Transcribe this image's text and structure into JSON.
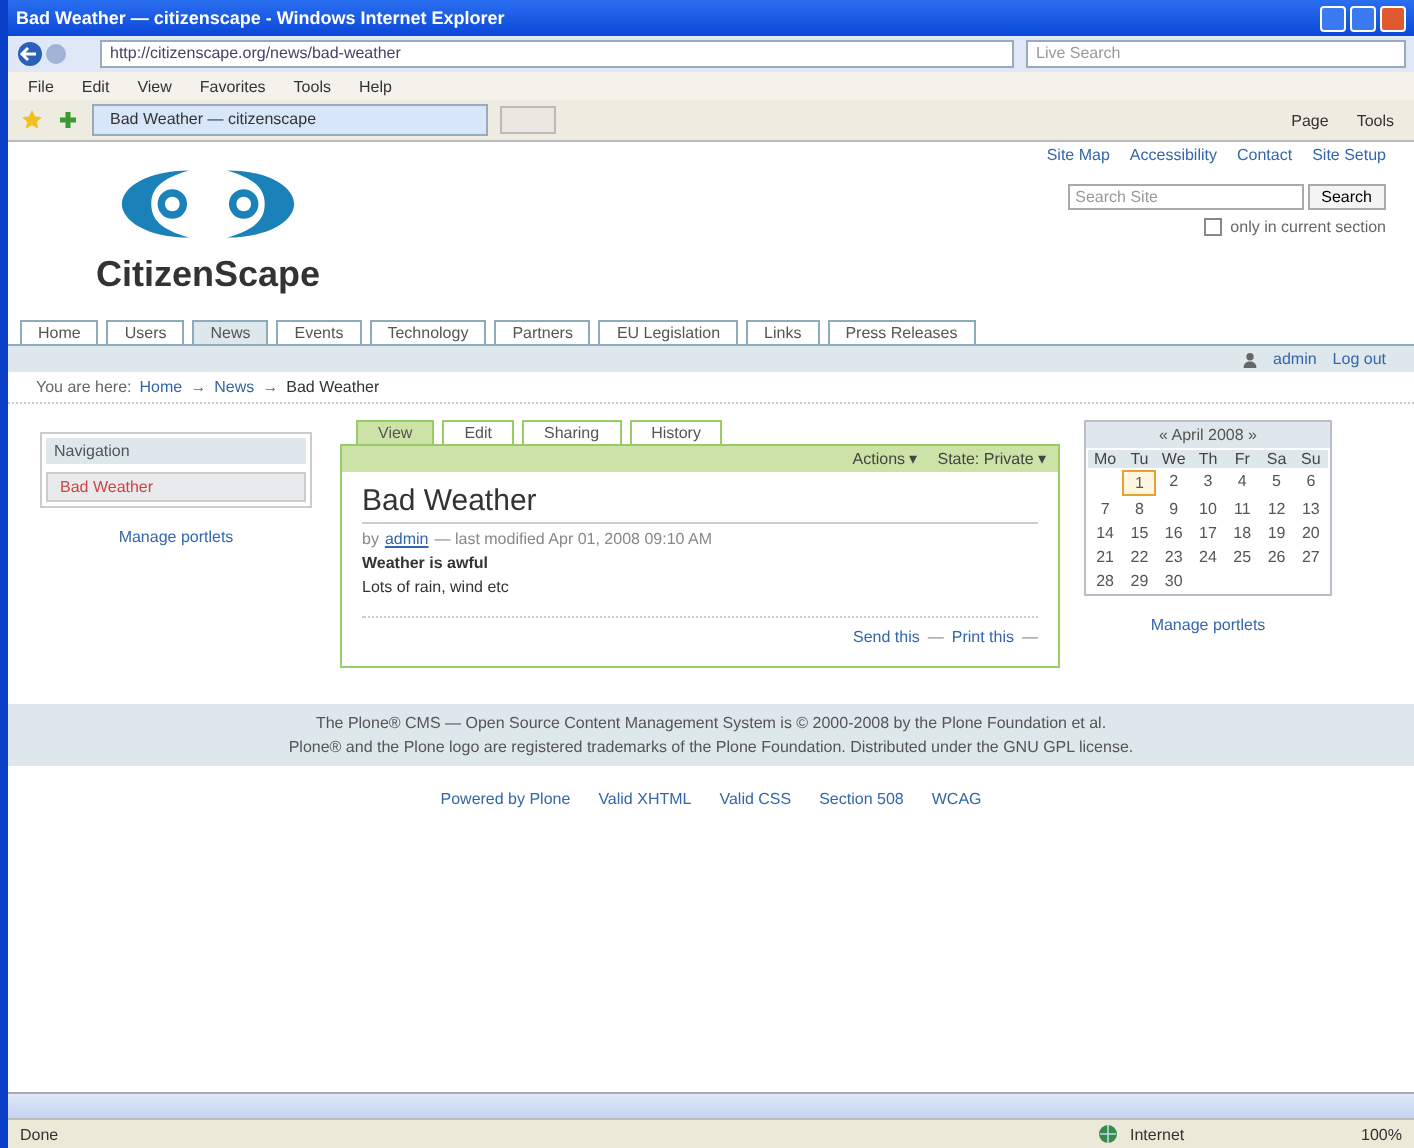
{
  "window": {
    "title": "Bad Weather — citizenscape - Windows Internet Explorer"
  },
  "address_bar": {
    "url": "http://citizenscape.org/news/bad-weather",
    "search_placeholder": "Live Search"
  },
  "menu": [
    "File",
    "Edit",
    "View",
    "Favorites",
    "Tools",
    "Help"
  ],
  "browser_tab": {
    "label": "Bad Weather — citizenscape"
  },
  "toolbar": [
    "Page",
    "Tools"
  ],
  "page": {
    "site_actions": [
      "Site Map",
      "Accessibility",
      "Contact",
      "Site Setup"
    ],
    "search": {
      "placeholder": "Search Site",
      "button": "Search",
      "option": "only in current section",
      "checked": false
    },
    "logo": {
      "text": "CitizenScape"
    },
    "nav_tabs": [
      {
        "label": "Home",
        "selected": false
      },
      {
        "label": "Users",
        "selected": false
      },
      {
        "label": "News",
        "selected": true
      },
      {
        "label": "Events",
        "selected": false
      },
      {
        "label": "Technology",
        "selected": false
      },
      {
        "label": "Partners",
        "selected": false
      },
      {
        "label": "EU Legislation",
        "selected": false
      },
      {
        "label": "Links",
        "selected": false
      },
      {
        "label": "Press Releases",
        "selected": false
      }
    ],
    "user_actions": [
      "admin",
      "Log out"
    ],
    "breadcrumb": {
      "label": "You are here:",
      "separator": "→",
      "items": [
        "Home",
        "News",
        "Bad Weather"
      ]
    },
    "nav_portlet": {
      "title": "Navigation",
      "items": [
        {
          "label": "Bad Weather",
          "selected": true
        }
      ],
      "manage": "Manage portlets"
    },
    "content_tabs": [
      {
        "label": "View",
        "selected": true
      },
      {
        "label": "Edit",
        "selected": false
      },
      {
        "label": "Sharing",
        "selected": false
      },
      {
        "label": "History",
        "selected": false
      }
    ],
    "content_menus": [
      "Actions ▾",
      "State: Private ▾"
    ],
    "article": {
      "title": "Bad Weather",
      "byline_prefix": "by",
      "author": "admin",
      "byline_rest": "— last modified Apr 01, 2008 09:10 AM",
      "description": "Weather is awful",
      "body": "Lots of rain, wind etc",
      "document_actions": [
        "Send this",
        "Print this"
      ],
      "action_separator": "—"
    },
    "calendar": {
      "title": "« April 2008 »",
      "weekdays": [
        "Mo",
        "Tu",
        "We",
        "Th",
        "Fr",
        "Sa",
        "Su"
      ],
      "weeks": [
        [
          {
            "kind": "blank"
          },
          {
            "label": "1",
            "today": true
          },
          {
            "label": "2",
            "today": false
          },
          {
            "label": "3",
            "today": false
          },
          {
            "label": "4",
            "today": false
          },
          {
            "label": "5",
            "today": false
          },
          {
            "label": "6",
            "today": false
          }
        ],
        [
          {
            "label": "7",
            "today": false
          },
          {
            "label": "8",
            "today": false
          },
          {
            "label": "9",
            "today": false
          },
          {
            "label": "10",
            "today": false
          },
          {
            "label": "11",
            "today": false
          },
          {
            "label": "12",
            "today": false
          },
          {
            "label": "13",
            "today": false
          }
        ],
        [
          {
            "label": "14",
            "today": false
          },
          {
            "label": "15",
            "today": false
          },
          {
            "label": "16",
            "today": false
          },
          {
            "label": "17",
            "today": false
          },
          {
            "label": "18",
            "today": false
          },
          {
            "label": "19",
            "today": false
          },
          {
            "label": "20",
            "today": false
          }
        ],
        [
          {
            "label": "21",
            "today": false
          },
          {
            "label": "22",
            "today": false
          },
          {
            "label": "23",
            "today": false
          },
          {
            "label": "24",
            "today": false
          },
          {
            "label": "25",
            "today": false
          },
          {
            "label": "26",
            "today": false
          },
          {
            "label": "27",
            "today": false
          }
        ],
        [
          {
            "label": "28",
            "today": false
          },
          {
            "label": "29",
            "today": false
          },
          {
            "label": "30",
            "today": false
          },
          {
            "kind": "blank"
          },
          {
            "kind": "blank"
          },
          {
            "kind": "blank"
          },
          {
            "kind": "blank"
          }
        ]
      ],
      "manage": "Manage portlets"
    },
    "footer": [
      "The Plone® CMS — Open Source Content Management System is © 2000-2008 by the Plone Foundation et al.",
      "Plone® and the Plone logo are registered trademarks of the Plone Foundation. Distributed under the GNU GPL license."
    ],
    "colophon": [
      "Powered by Plone",
      "Valid XHTML",
      "Valid CSS",
      "Section 508",
      "WCAG"
    ]
  },
  "status_bar": {
    "text": "Done",
    "zone": "Internet",
    "zoom": "100%"
  }
}
